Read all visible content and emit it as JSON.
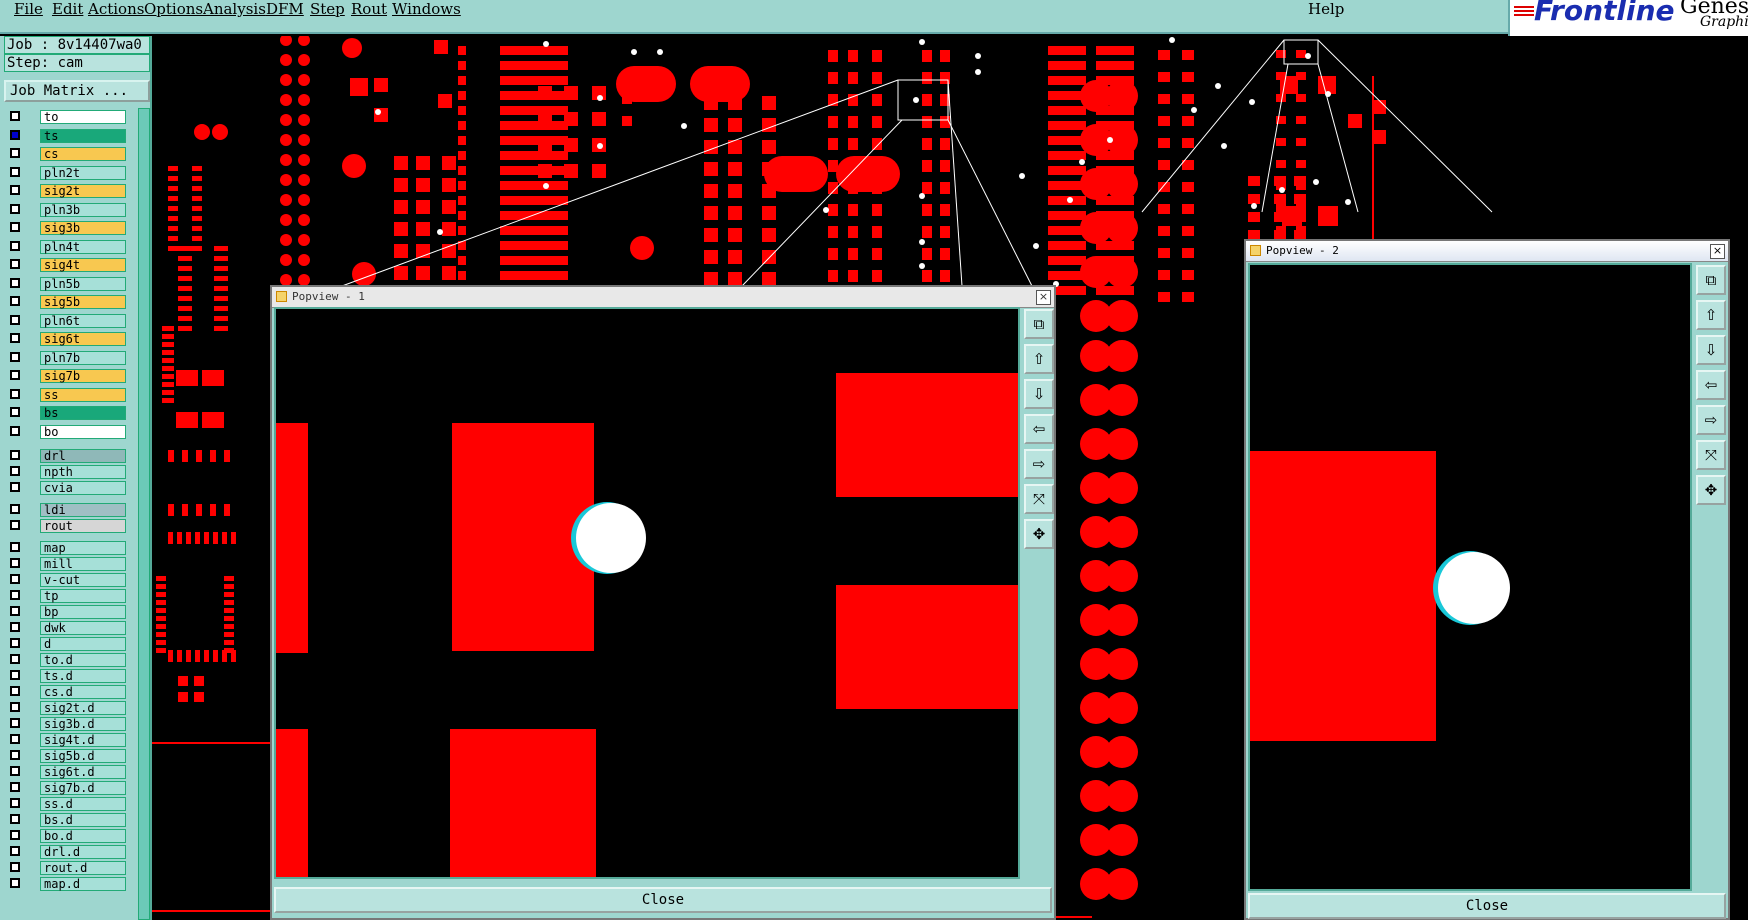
{
  "menu": {
    "items": [
      "File",
      "Edit",
      "Actions",
      "Options",
      "Analysis",
      "DFM",
      "Step",
      "Rout",
      "Windows"
    ],
    "help": "Help"
  },
  "logo": {
    "brand": "Frontline",
    "product": "Genesi",
    "sub": "Graphic"
  },
  "job": {
    "job_line": "Job : 8v14407wa0",
    "step_line": "Step: cam",
    "matrix_button": "Job Matrix ..."
  },
  "layers": [
    {
      "name": "to",
      "color": "#ffffff",
      "checked": false
    },
    {
      "name": "ts",
      "color": "#19a87a",
      "checked": true
    },
    {
      "name": "cs",
      "color": "#f8c850",
      "checked": false
    },
    {
      "name": "pln2t",
      "color": "#a6e0d8",
      "checked": false
    },
    {
      "name": "sig2t",
      "color": "#f8c850",
      "checked": false
    },
    {
      "name": "pln3b",
      "color": "#a6e0d8",
      "checked": false
    },
    {
      "name": "sig3b",
      "color": "#f8c850",
      "checked": false
    },
    {
      "name": "pln4t",
      "color": "#a6e0d8",
      "checked": false
    },
    {
      "name": "sig4t",
      "color": "#f8c850",
      "checked": false
    },
    {
      "name": "pln5b",
      "color": "#a6e0d8",
      "checked": false
    },
    {
      "name": "sig5b",
      "color": "#f8c850",
      "checked": false
    },
    {
      "name": "pln6t",
      "color": "#a6e0d8",
      "checked": false
    },
    {
      "name": "sig6t",
      "color": "#f8c850",
      "checked": false
    },
    {
      "name": "pln7b",
      "color": "#a6e0d8",
      "checked": false
    },
    {
      "name": "sig7b",
      "color": "#f8c850",
      "checked": false
    },
    {
      "name": "ss",
      "color": "#f8c850",
      "checked": false
    },
    {
      "name": "bs",
      "color": "#19a87a",
      "checked": false
    },
    {
      "name": "bo",
      "color": "#ffffff",
      "checked": false
    },
    {
      "name": "drl",
      "color": "#8fb8b8",
      "checked": false
    },
    {
      "name": "npth",
      "color": "#a6e0d8",
      "checked": false
    },
    {
      "name": "cvia",
      "color": "#a6e0d8",
      "checked": false
    },
    {
      "name": "ldi",
      "color": "#9fbfc4",
      "checked": false
    },
    {
      "name": "rout",
      "color": "#d6d6d6",
      "checked": false
    },
    {
      "name": "map",
      "color": "#a6e0d8",
      "checked": false
    },
    {
      "name": "mill",
      "color": "#a6e0d8",
      "checked": false
    },
    {
      "name": "v-cut",
      "color": "#a6e0d8",
      "checked": false
    },
    {
      "name": "tp",
      "color": "#a6e0d8",
      "checked": false
    },
    {
      "name": "bp",
      "color": "#a6e0d8",
      "checked": false
    },
    {
      "name": "dwk",
      "color": "#a6e0d8",
      "checked": false
    },
    {
      "name": "d",
      "color": "#a6e0d8",
      "checked": false
    },
    {
      "name": "to.d",
      "color": "#a6e0d8",
      "checked": false
    },
    {
      "name": "ts.d",
      "color": "#a6e0d8",
      "checked": false
    },
    {
      "name": "cs.d",
      "color": "#a6e0d8",
      "checked": false
    },
    {
      "name": "sig2t.d",
      "color": "#a6e0d8",
      "checked": false
    },
    {
      "name": "sig3b.d",
      "color": "#a6e0d8",
      "checked": false
    },
    {
      "name": "sig4t.d",
      "color": "#a6e0d8",
      "checked": false
    },
    {
      "name": "sig5b.d",
      "color": "#a6e0d8",
      "checked": false
    },
    {
      "name": "sig6t.d",
      "color": "#a6e0d8",
      "checked": false
    },
    {
      "name": "sig7b.d",
      "color": "#a6e0d8",
      "checked": false
    },
    {
      "name": "ss.d",
      "color": "#a6e0d8",
      "checked": false
    },
    {
      "name": "bs.d",
      "color": "#a6e0d8",
      "checked": false
    },
    {
      "name": "bo.d",
      "color": "#a6e0d8",
      "checked": false
    },
    {
      "name": "drl.d",
      "color": "#a6e0d8",
      "checked": false
    },
    {
      "name": "rout.d",
      "color": "#a6e0d8",
      "checked": false
    },
    {
      "name": "map.d",
      "color": "#a6e0d8",
      "checked": false
    }
  ],
  "popview1": {
    "title": "Popview - 1",
    "close_label": "Close"
  },
  "popview2": {
    "title": "Popview - 2",
    "close_label": "Close"
  },
  "toolbar_icons": [
    "zoom-home-icon",
    "pan-up-icon",
    "pan-down-icon",
    "pan-left-icon",
    "pan-right-icon",
    "zoom-out-icon",
    "zoom-in-icon"
  ],
  "colors": {
    "copper": "#ff0000",
    "panel": "#9ed6cf",
    "background": "#000000",
    "drill": "#ffffff"
  }
}
